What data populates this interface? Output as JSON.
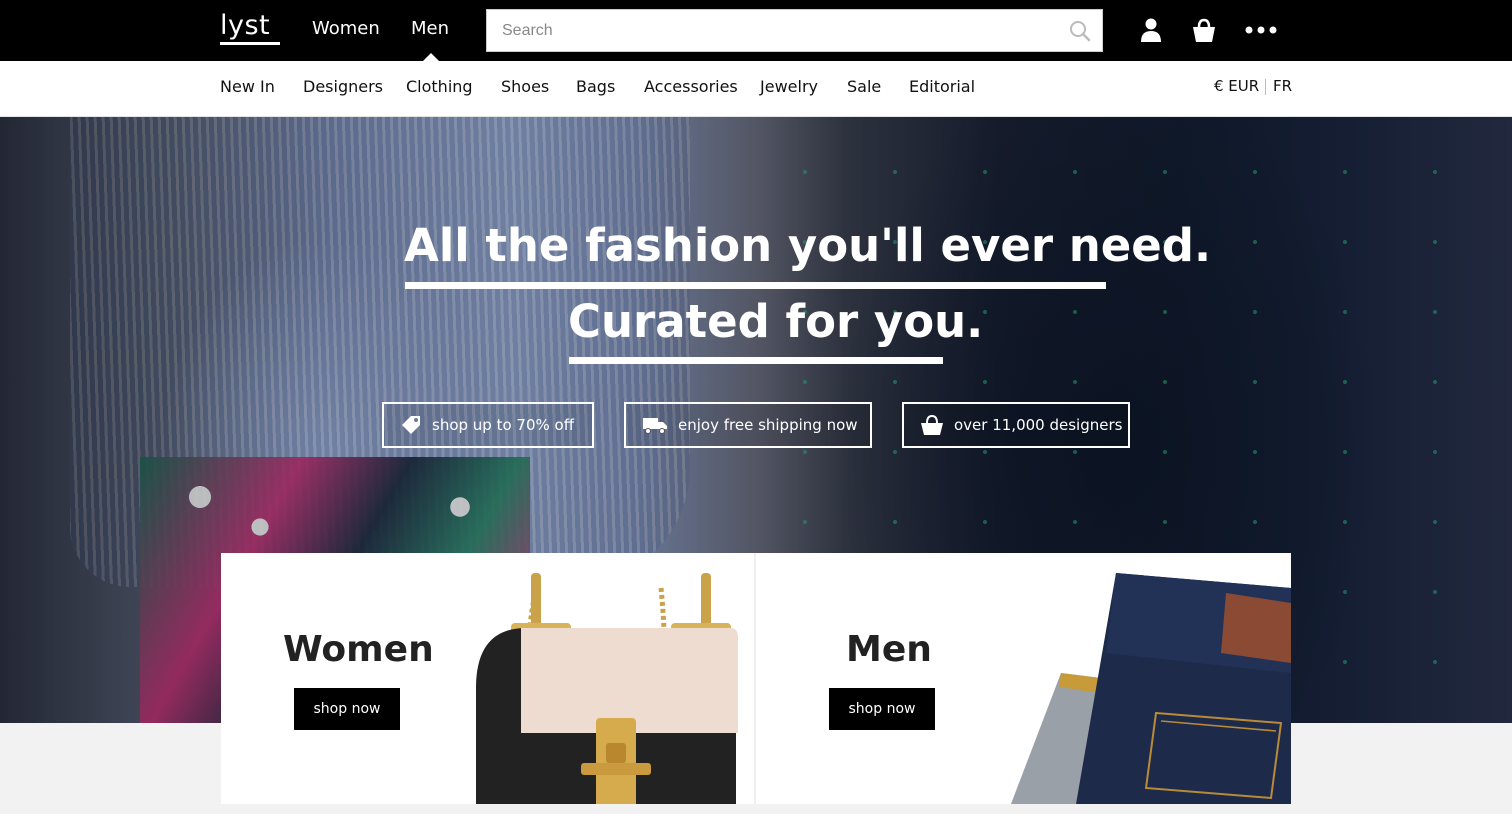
{
  "header": {
    "logo": "lyst",
    "gender_tabs": [
      {
        "label": "Women"
      },
      {
        "label": "Men"
      }
    ],
    "search": {
      "placeholder": "Search"
    },
    "icons": [
      "user-icon",
      "shopping-bag-icon",
      "more-icon"
    ]
  },
  "category_nav": {
    "items": [
      "New In",
      "Designers",
      "Clothing",
      "Shoes",
      "Bags",
      "Accessories",
      "Jewelry",
      "Sale",
      "Editorial"
    ],
    "currency": "€ EUR",
    "language": "FR"
  },
  "hero": {
    "headline_1": "All the fashion you'll ever need.",
    "headline_2": "Curated for you.",
    "perks": [
      {
        "label": "shop up to 70% off",
        "icon": "tag-icon"
      },
      {
        "label": "enjoy free shipping now",
        "icon": "truck-icon"
      },
      {
        "label": "over 11,000 designers",
        "icon": "basket-icon"
      }
    ]
  },
  "promo_cards": [
    {
      "title": "Women",
      "button": "shop now",
      "image": "handbag"
    },
    {
      "title": "Men",
      "button": "shop now",
      "image": "jeans"
    }
  ],
  "colors": {
    "topbar": "#000000",
    "accent_dots": "#2fbf8a",
    "button": "#000000"
  }
}
